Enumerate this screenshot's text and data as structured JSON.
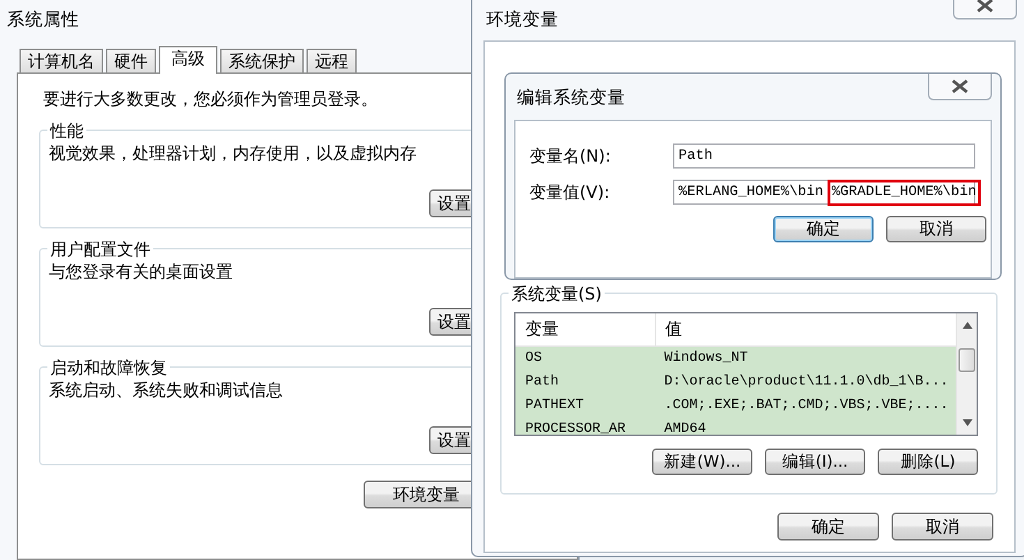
{
  "system_properties": {
    "title": "系统属性",
    "tabs": [
      {
        "label": "计算机名",
        "selected": false
      },
      {
        "label": "硬件",
        "selected": false
      },
      {
        "label": "高级",
        "selected": true
      },
      {
        "label": "系统保护",
        "selected": false
      },
      {
        "label": "远程",
        "selected": false
      }
    ],
    "notice": "要进行大多数更改，您必须作为管理员登录。",
    "groups": [
      {
        "title": "性能",
        "description": "视觉效果，处理器计划，内存使用，以及虚拟内存",
        "button": "设置"
      },
      {
        "title": "用户配置文件",
        "description": "与您登录有关的桌面设置",
        "button": "设置"
      },
      {
        "title": "启动和故障恢复",
        "description": "系统启动、系统失败和调试信息",
        "button": "设置"
      }
    ],
    "env_button": "环境变量"
  },
  "environment_variables": {
    "title": "环境变量",
    "system_variables": {
      "title": "系统变量(S)",
      "columns": [
        "变量",
        "值"
      ],
      "rows": [
        {
          "name": "OS",
          "value": "Windows_NT"
        },
        {
          "name": "Path",
          "value": "D:\\oracle\\product\\11.1.0\\db_1\\B..."
        },
        {
          "name": "PATHEXT",
          "value": ".COM;.EXE;.BAT;.CMD;.VBS;.VBE;...."
        },
        {
          "name": "PROCESSOR_AR",
          "value": "AMD64"
        }
      ],
      "buttons": [
        "新建(W)...",
        "编辑(I)...",
        "删除(L)"
      ]
    },
    "buttons": [
      {
        "label": "确定",
        "default": false
      },
      {
        "label": "取消",
        "default": false
      }
    ]
  },
  "edit_dialog": {
    "title": "编辑系统变量",
    "fields": [
      {
        "label": "变量名(N):",
        "parts": [
          {
            "text": "Path",
            "highlighted": false
          }
        ]
      },
      {
        "label": "变量值(V):",
        "parts": [
          {
            "text": "%ERLANG_HOME%\\bin",
            "highlighted": false
          },
          {
            "text": "%GRADLE_HOME%\\bin",
            "highlighted": true
          }
        ]
      }
    ],
    "buttons": [
      {
        "label": "确定",
        "default": true
      },
      {
        "label": "取消",
        "default": false
      }
    ]
  }
}
